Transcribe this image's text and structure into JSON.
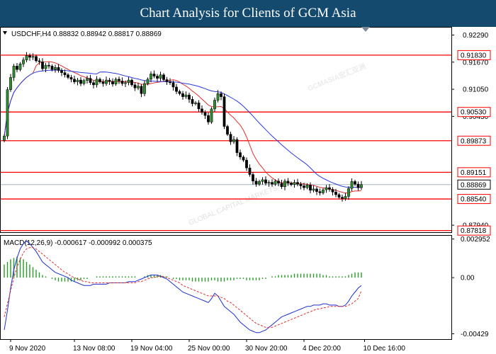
{
  "banner": {
    "title": "Chart Analysis for Clients of GCM Asia"
  },
  "watermark": {
    "text": "GCMASIA宏汇亚洲",
    "subtext": "GLOBAL CAPITAL MARKETS"
  },
  "colors": {
    "bull": "#2e8b2e",
    "bear": "#000000",
    "ma_fast": "#e03030",
    "ma_slow": "#2a3adf",
    "level": "#ff0000",
    "macd_hist": "#2a9a2a",
    "macd_line": "#1c2fd0",
    "signal_line": "#e03030",
    "banner_bg": "#134a6e"
  },
  "chart_data": [
    {
      "type": "candlestick",
      "header": "USDCHF,H4  0.88832 0.88942 0.88817 0.88869",
      "symbol": "USDCHF,H4",
      "ohlc_last": [
        0.88832,
        0.88942,
        0.88817,
        0.88869
      ],
      "ylim": [
        0.8778,
        0.9246
      ],
      "y_ticks": [
        0.9229,
        0.9167,
        0.9105,
        0.9043,
        0.8794
      ],
      "y_tick_labels": [
        "0.92290",
        "0.91670",
        "0.91050",
        "0.90430",
        "0.87940"
      ],
      "x_tick_labels": [
        "9 Nov 2020",
        "13 Nov 08:00",
        "19 Nov 04:00",
        "25 Nov 00:00",
        "30 Nov 20:00",
        "4 Dec 20:00",
        "10 Dec 16:00"
      ],
      "x_tick_index": [
        2,
        22,
        40,
        58,
        76,
        94,
        113
      ],
      "levels": [
        0.9183,
        0.9053,
        0.89873,
        0.89151,
        0.8854,
        0.87818
      ],
      "level_labels": [
        "0.91830",
        "0.90530",
        "0.89873",
        "0.89151",
        "0.88540",
        "0.87818"
      ],
      "current_price": 0.88869,
      "current_price_label": "0.88869",
      "closes": [
        0.8998,
        0.9104,
        0.9132,
        0.9158,
        0.915,
        0.9163,
        0.9172,
        0.9182,
        0.9178,
        0.918,
        0.917,
        0.9168,
        0.9152,
        0.916,
        0.9158,
        0.915,
        0.9155,
        0.9148,
        0.9143,
        0.9138,
        0.9132,
        0.9128,
        0.9122,
        0.9126,
        0.9118,
        0.9125,
        0.913,
        0.912,
        0.9115,
        0.9128,
        0.9122,
        0.9118,
        0.9126,
        0.9123,
        0.9117,
        0.9128,
        0.9124,
        0.9118,
        0.912,
        0.9126,
        0.9115,
        0.9108,
        0.9112,
        0.9095,
        0.9118,
        0.9128,
        0.914,
        0.9135,
        0.913,
        0.9138,
        0.9127,
        0.9122,
        0.912,
        0.911,
        0.91,
        0.9095,
        0.9088,
        0.9092,
        0.9082,
        0.9072,
        0.9074,
        0.906,
        0.9052,
        0.9045,
        0.903,
        0.906,
        0.908,
        0.9095,
        0.9088,
        0.902,
        0.9002,
        0.8985,
        0.899,
        0.896,
        0.895,
        0.8943,
        0.8925,
        0.891,
        0.8895,
        0.8888,
        0.8894,
        0.8898,
        0.889,
        0.8892,
        0.8888,
        0.8895,
        0.889,
        0.8882,
        0.8895,
        0.889,
        0.8887,
        0.8892,
        0.8888,
        0.8884,
        0.888,
        0.8886,
        0.8874,
        0.8877,
        0.8871,
        0.8868,
        0.8875,
        0.888,
        0.8876,
        0.887,
        0.8864,
        0.8858,
        0.8855,
        0.886,
        0.8878,
        0.8894,
        0.8888,
        0.888,
        0.8887
      ]
    },
    {
      "type": "bar+line",
      "header": "MACD(12,26,9) -0.000617 -0.000992 0.000375",
      "ylim": [
        -0.0047,
        0.0032
      ],
      "y_ticks": [
        0.002952,
        0.0,
        -0.00429
      ],
      "y_tick_labels": [
        "0.002952",
        "0.00",
        "-0.00429"
      ],
      "histogram": [
        0.001,
        0.0012,
        0.0014,
        0.0015,
        0.0016,
        0.0015,
        0.0014,
        0.0012,
        0.001,
        0.0008,
        0.0006,
        0.0004,
        0.0002,
        0.0001,
        0.0,
        -0.0001,
        -0.0002,
        -0.0003,
        -0.0003,
        -0.0003,
        -0.0003,
        -0.0003,
        -0.0003,
        -0.0002,
        -0.0002,
        -0.0001,
        -0.0001,
        0.0,
        0.0,
        0.0001,
        0.0001,
        0.0001,
        0.0001,
        0.0001,
        0.0001,
        0.0001,
        0.0001,
        0.0001,
        0.0001,
        0.0001,
        0.0001,
        0.0001,
        0.0,
        0.0,
        0.0001,
        0.0002,
        0.0002,
        0.0002,
        0.0002,
        0.0002,
        0.0001,
        0.0001,
        0.0,
        -0.0001,
        -0.0001,
        -0.0002,
        -0.0002,
        -0.0002,
        -0.0002,
        -0.0003,
        -0.0003,
        -0.0003,
        -0.0003,
        -0.0003,
        -0.0003,
        -0.0002,
        -0.0002,
        -0.0003,
        -0.0003,
        -0.0003,
        -0.0002,
        -0.0002,
        -0.0002,
        -0.0001,
        -0.0001,
        -0.0001,
        -0.0002,
        -0.0002,
        -0.0002,
        -0.0002,
        -0.0002,
        -0.0001,
        -0.0001,
        0.0,
        0.0001,
        0.0001,
        0.0002,
        0.0002,
        0.0002,
        0.0002,
        0.0002,
        0.0003,
        0.0003,
        0.0003,
        0.0003,
        0.0003,
        0.0003,
        0.0003,
        0.0003,
        0.0003,
        0.0002,
        0.0002,
        0.0001,
        0.0001,
        0.0001,
        0.0001,
        0.0001,
        0.0001,
        0.0002,
        0.0003,
        0.0004,
        0.0004,
        0.0004
      ],
      "macd": [
        -0.004,
        -0.0025,
        -0.0008,
        0.0006,
        0.0015,
        0.0022,
        0.0026,
        0.0028,
        0.0026,
        0.0023,
        0.002,
        0.0016,
        0.0012,
        0.001,
        0.0008,
        0.0006,
        0.0004,
        0.0003,
        0.0002,
        0.0001,
        0.0,
        -0.0002,
        -0.0003,
        -0.0004,
        -0.0005,
        -0.0006,
        -0.0006,
        -0.0006,
        -0.0005,
        -0.0005,
        -0.0005,
        -0.0005,
        -0.0005,
        -0.0004,
        -0.0004,
        -0.0004,
        -0.0004,
        -0.0004,
        -0.0004,
        -0.0003,
        -0.0003,
        -0.0003,
        -0.0002,
        -0.0001,
        0.0,
        0.0001,
        0.0002,
        0.0002,
        0.0002,
        0.0001,
        0.0,
        -0.0001,
        -0.0003,
        -0.0005,
        -0.0007,
        -0.0009,
        -0.0011,
        -0.0012,
        -0.0013,
        -0.0014,
        -0.0015,
        -0.0016,
        -0.0017,
        -0.0018,
        -0.0019,
        -0.0016,
        -0.0012,
        -0.0014,
        -0.0018,
        -0.0022,
        -0.0024,
        -0.0026,
        -0.0028,
        -0.0031,
        -0.0034,
        -0.0036,
        -0.0038,
        -0.004,
        -0.0041,
        -0.0042,
        -0.0042,
        -0.0041,
        -0.004,
        -0.0038,
        -0.0036,
        -0.0034,
        -0.0032,
        -0.003,
        -0.0029,
        -0.0028,
        -0.0027,
        -0.0026,
        -0.0025,
        -0.0024,
        -0.0023,
        -0.0022,
        -0.0022,
        -0.0021,
        -0.0021,
        -0.0021,
        -0.002,
        -0.002,
        -0.0021,
        -0.0021,
        -0.0021,
        -0.0022,
        -0.0022,
        -0.0021,
        -0.0018,
        -0.0014,
        -0.0011,
        -0.0008,
        -0.0006
      ],
      "signal": [
        -0.003,
        -0.002,
        -0.001,
        0.0,
        0.0008,
        0.0014,
        0.0019,
        0.0022,
        0.0023,
        0.0023,
        0.0022,
        0.002,
        0.0018,
        0.0016,
        0.0014,
        0.0012,
        0.001,
        0.0008,
        0.0006,
        0.0004,
        0.0003,
        0.0001,
        0.0,
        -0.0001,
        -0.0002,
        -0.0003,
        -0.0003,
        -0.0004,
        -0.0004,
        -0.0004,
        -0.0004,
        -0.0004,
        -0.0004,
        -0.0004,
        -0.0004,
        -0.0004,
        -0.0004,
        -0.0004,
        -0.0004,
        -0.0004,
        -0.0004,
        -0.0004,
        -0.0003,
        -0.0003,
        -0.0002,
        -0.0001,
        0.0,
        0.0,
        0.0001,
        0.0001,
        0.0001,
        0.0,
        -0.0001,
        -0.0002,
        -0.0003,
        -0.0004,
        -0.0006,
        -0.0007,
        -0.0008,
        -0.0009,
        -0.001,
        -0.0011,
        -0.0012,
        -0.0013,
        -0.0014,
        -0.0014,
        -0.0014,
        -0.0014,
        -0.0015,
        -0.0016,
        -0.0018,
        -0.0019,
        -0.0021,
        -0.0023,
        -0.0025,
        -0.0027,
        -0.0029,
        -0.0031,
        -0.0033,
        -0.0035,
        -0.0036,
        -0.0037,
        -0.0038,
        -0.0038,
        -0.0038,
        -0.0037,
        -0.0036,
        -0.0035,
        -0.0034,
        -0.0033,
        -0.0032,
        -0.0031,
        -0.003,
        -0.0029,
        -0.0028,
        -0.0027,
        -0.0026,
        -0.0025,
        -0.0024,
        -0.0024,
        -0.0023,
        -0.0023,
        -0.0022,
        -0.0022,
        -0.0022,
        -0.0022,
        -0.0022,
        -0.0022,
        -0.0021,
        -0.002,
        -0.0018,
        -0.0016,
        -0.001
      ]
    }
  ]
}
